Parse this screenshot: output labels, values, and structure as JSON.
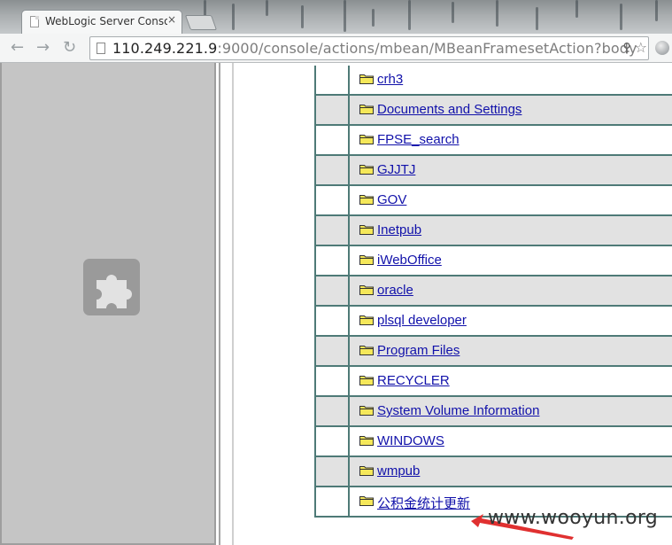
{
  "browser": {
    "tab_title": "WebLogic Server Conso",
    "tab_close": "×",
    "url_host": "110.249.221.9",
    "url_rest": ":9000/console/actions/mbean/MBeanFramesetAction?body",
    "back": "←",
    "forward": "→",
    "reload": "↻",
    "star": "☆"
  },
  "folders": [
    {
      "name": "crh3"
    },
    {
      "name": "Documents and Settings"
    },
    {
      "name": "FPSE_search"
    },
    {
      "name": "GJJTJ"
    },
    {
      "name": "GOV"
    },
    {
      "name": "Inetpub"
    },
    {
      "name": "iWebOffice"
    },
    {
      "name": "oracle"
    },
    {
      "name": "plsql developer"
    },
    {
      "name": "Program Files"
    },
    {
      "name": "RECYCLER"
    },
    {
      "name": "System Volume Information"
    },
    {
      "name": "WINDOWS"
    },
    {
      "name": "wmpub"
    },
    {
      "name": "公积金统计更新"
    }
  ],
  "watermark": "www.wooyun.org",
  "colors": {
    "link": "#1111aa",
    "row_alt": "#e2e2e2",
    "border": "#4e7a77",
    "folder_fill": "#f5e85a",
    "arrow": "#e03030"
  }
}
